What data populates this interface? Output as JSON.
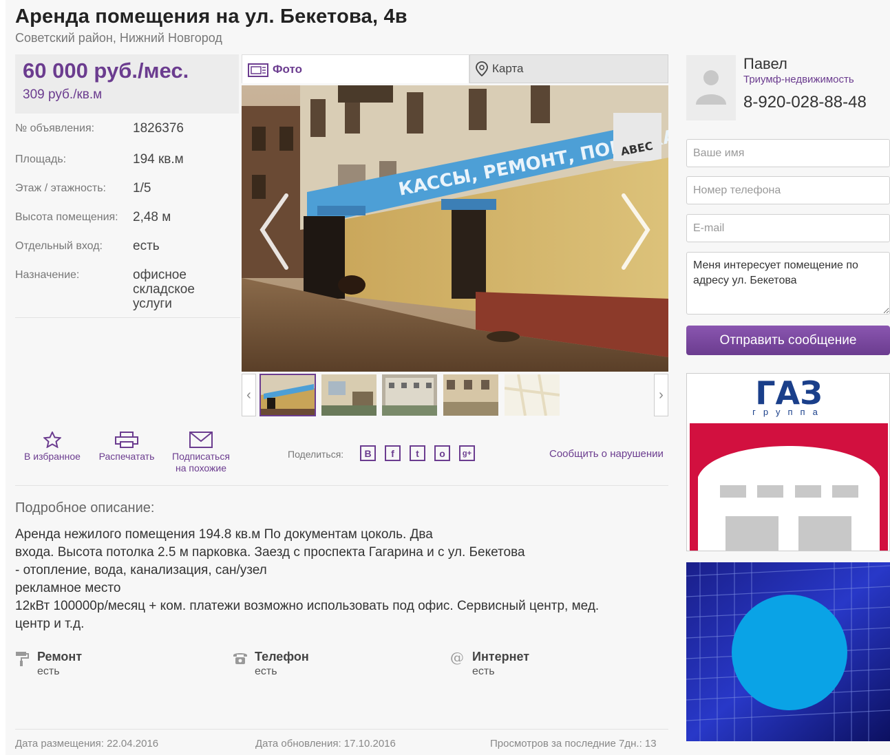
{
  "listing": {
    "title": "Аренда помещения на ул. Бекетова, 4в",
    "location": "Советский район, Нижний Новгород",
    "price": "60 000 руб./мес.",
    "price_per_sqm": "309 руб./кв.м"
  },
  "params": [
    {
      "label": "№ объявления:",
      "value": "1826376"
    },
    {
      "label": "Площадь:",
      "value": "194 кв.м"
    },
    {
      "label": "Этаж / этажность:",
      "value": "1/5"
    },
    {
      "label": "Высота помещения:",
      "value": "2,48 м"
    },
    {
      "label": "Отдельный вход:",
      "value": "есть"
    },
    {
      "label": "Назначение:",
      "values": [
        "офисное",
        "складское",
        "услуги"
      ]
    }
  ],
  "gallery": {
    "tab_photo": "Фото",
    "tab_map": "Карта",
    "sign_text": "КАССЫ, РЕМОНТ, ПОВЕРКА",
    "sign_logo": "АВЕС"
  },
  "actions": {
    "favorite": "В избранное",
    "print": "Распечатать",
    "subscribe_line1": "Подписаться",
    "subscribe_line2": "на похожие",
    "share_label": "Поделиться:",
    "share": [
      "В",
      "f",
      "t",
      "о",
      "g+"
    ],
    "report": "Сообщить о нарушении"
  },
  "description": {
    "heading": "Подробное описание:",
    "lines": [
      "Аренда нежилого помещения 194.8 кв.м По документам цоколь. Два",
      "входа. Высота потолка 2.5 м парковка. Заезд с проспекта Гагарина и с ул. Бекетова",
      "- отопление, вода, канализация, сан/узел",
      "рекламное место",
      "12кВт 100000р/месяц + ком. платежи возможно использовать под офис. Сервисный центр, мед.",
      "центр и т.д."
    ]
  },
  "features": [
    {
      "title": "Ремонт",
      "value": "есть",
      "icon": "paint-roller-icon"
    },
    {
      "title": "Телефон",
      "value": "есть",
      "icon": "telephone-icon"
    },
    {
      "title": "Интернет",
      "value": "есть",
      "icon": "at-sign-icon"
    }
  ],
  "footer": {
    "posted": "Дата размещения: 22.04.2016",
    "updated": "Дата обновления: 17.10.2016",
    "views": "Просмотров за последние 7дн.: 13"
  },
  "agent": {
    "name": "Павел",
    "company": "Триумф-недвижимость",
    "phone": "8-920-028-88-48"
  },
  "form": {
    "name_placeholder": "Ваше имя",
    "phone_placeholder": "Номер телефона",
    "email_placeholder": "E-mail",
    "message": "Меня интересует помещение по адресу ул. Бекетова",
    "send_label": "Отправить сообщение"
  },
  "ads": {
    "gaz_logo": "ГАЗ",
    "gaz_sub": "группа"
  },
  "colors": {
    "accent": "#6b3c8f",
    "gaz_blue": "#1a3f8a",
    "gaz_red": "#d2103f",
    "ad_circle": "#0aa3e6"
  }
}
